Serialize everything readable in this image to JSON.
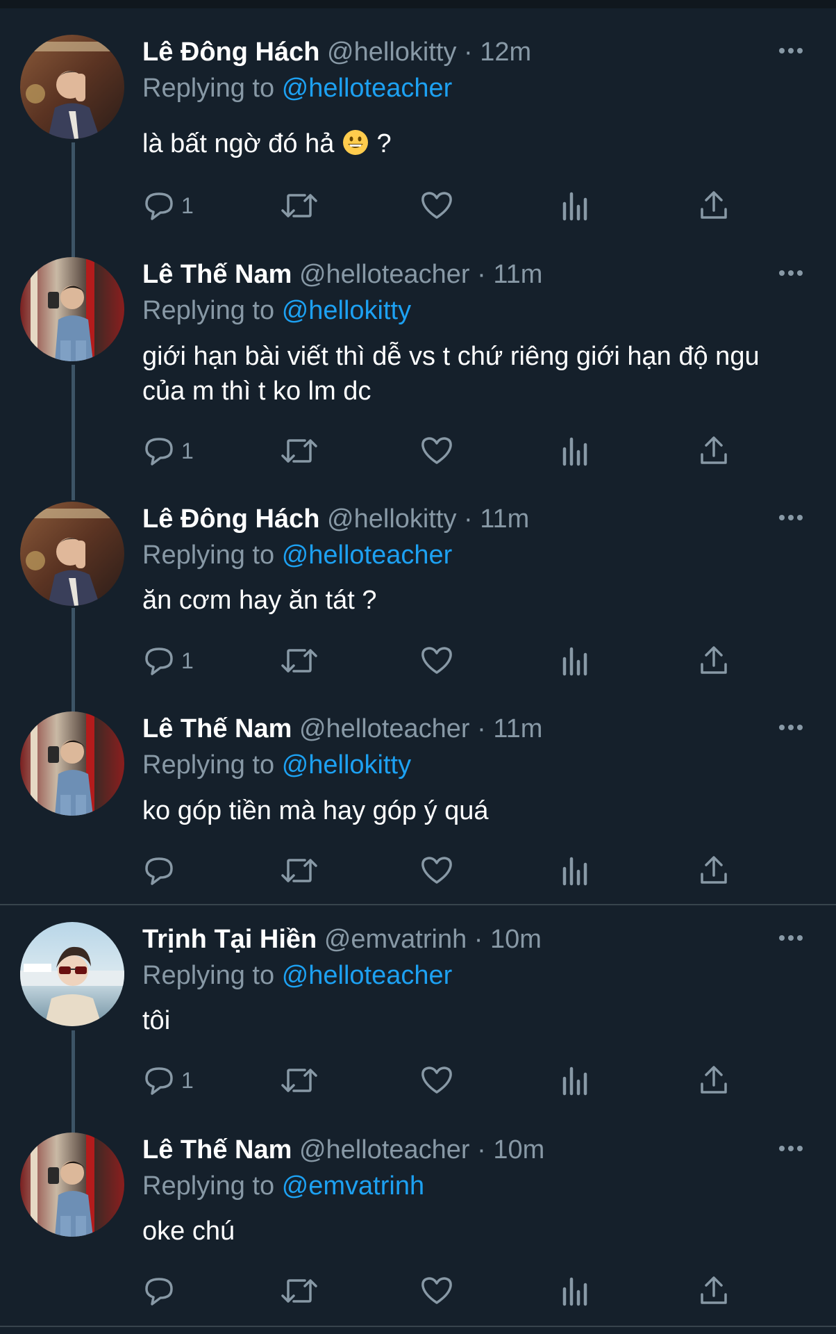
{
  "replying_label": "Replying to",
  "tweets": [
    {
      "name": "Lê Đông Hách",
      "handle": "@hellokitty",
      "dot": "·",
      "time": "12m",
      "reply_to": "@helloteacher",
      "text": "là bất ngờ đó hả",
      "text_suffix": " ?",
      "reply_count": "1"
    },
    {
      "name": "Lê Thế Nam",
      "handle": "@helloteacher",
      "dot": "·",
      "time": "11m",
      "reply_to": "@hellokitty",
      "text": "giới hạn bài viết thì dễ vs t chứ riêng giới hạn độ ngu của m thì t ko lm dc",
      "reply_count": "1"
    },
    {
      "name": "Lê Đông Hách",
      "handle": "@hellokitty",
      "dot": "·",
      "time": "11m",
      "reply_to": "@helloteacher",
      "text": "ăn cơm hay ăn tát ?",
      "reply_count": "1"
    },
    {
      "name": "Lê Thế Nam",
      "handle": "@helloteacher",
      "dot": "·",
      "time": "11m",
      "reply_to": "@hellokitty",
      "text": "ko góp tiền mà hay góp ý quá",
      "reply_count": ""
    },
    {
      "name": "Trịnh Tại Hiền",
      "handle": "@emvatrinh",
      "dot": "·",
      "time": "10m",
      "reply_to": "@helloteacher",
      "text": "tôi",
      "reply_count": "1"
    },
    {
      "name": "Lê Thế Nam",
      "handle": "@helloteacher",
      "dot": "·",
      "time": "10m",
      "reply_to": "@emvatrinh",
      "text": "oke chú",
      "reply_count": ""
    }
  ],
  "colors": {
    "background": "#15202b",
    "text": "#ffffff",
    "secondary": "#8899a6",
    "accent": "#1da1f2",
    "thread_line": "#3d5466",
    "separator": "#38444d"
  },
  "icons": {
    "more": "more-horizontal-icon",
    "reply": "reply-icon",
    "retweet": "retweet-icon",
    "like": "heart-icon",
    "analytics": "analytics-icon",
    "share": "share-icon",
    "emoji": "grinning-face-emoji"
  }
}
